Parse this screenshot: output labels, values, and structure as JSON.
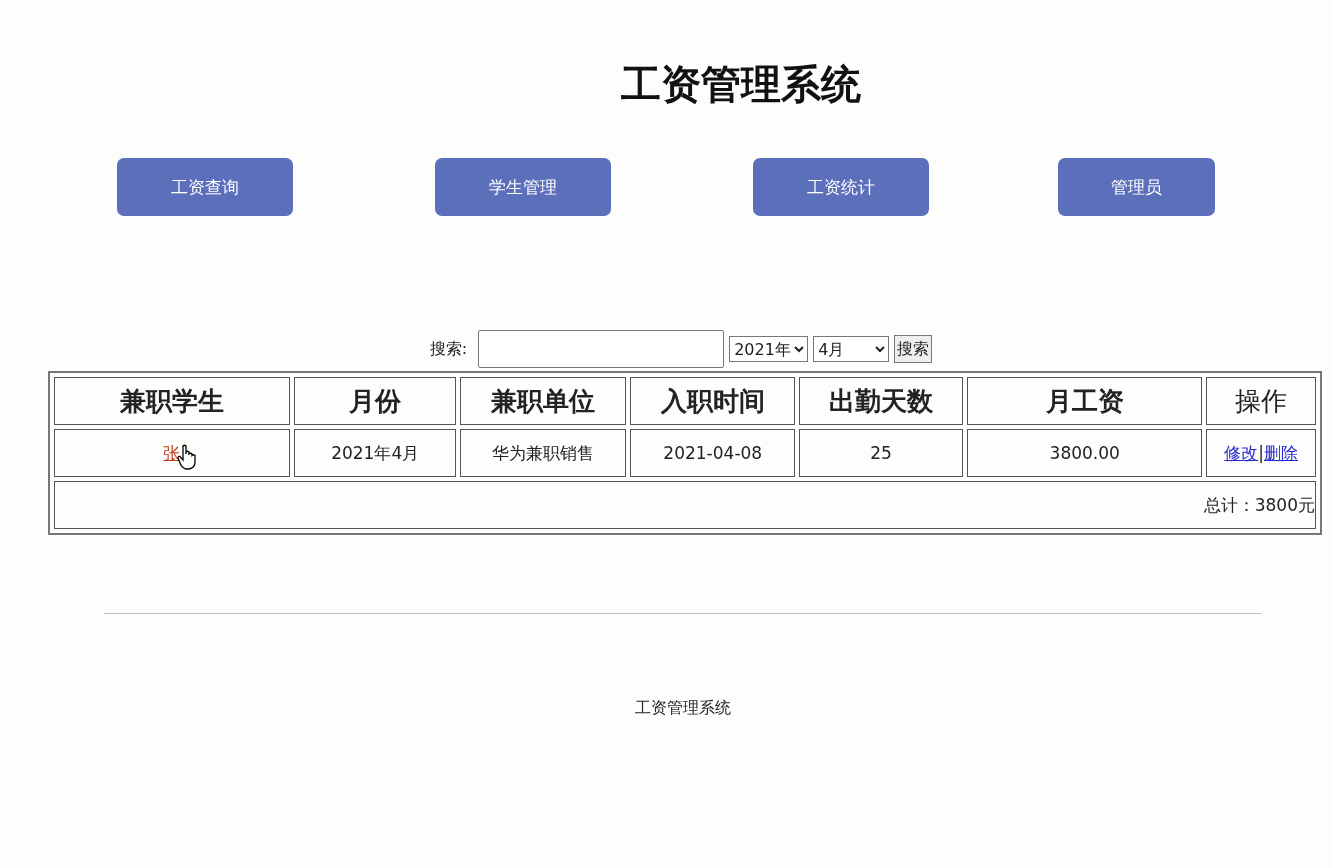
{
  "title": "工资管理系统",
  "nav": [
    {
      "label": "工资查询"
    },
    {
      "label": "学生管理"
    },
    {
      "label": "工资统计"
    },
    {
      "label": "管理员"
    }
  ],
  "search": {
    "label": "搜索:",
    "year": "2021年",
    "month": "4月",
    "button": "搜索"
  },
  "table": {
    "columns": [
      {
        "label": "兼职学生",
        "bold": true
      },
      {
        "label": "月份",
        "bold": true
      },
      {
        "label": "兼职单位",
        "bold": true
      },
      {
        "label": "入职时间",
        "bold": true
      },
      {
        "label": "出勤天数",
        "bold": true
      },
      {
        "label": "月工资",
        "bold": true
      },
      {
        "label": "操作",
        "bold": false
      }
    ],
    "rows": [
      {
        "student": "张",
        "month": "2021年4月",
        "unit": "华为兼职销售",
        "start": "2021-04-08",
        "days": "25",
        "salary": "3800.00",
        "actions": [
          "修改",
          "删除"
        ],
        "separator": "|"
      }
    ],
    "total": "总计：3800元"
  },
  "footer": "工资管理系统"
}
